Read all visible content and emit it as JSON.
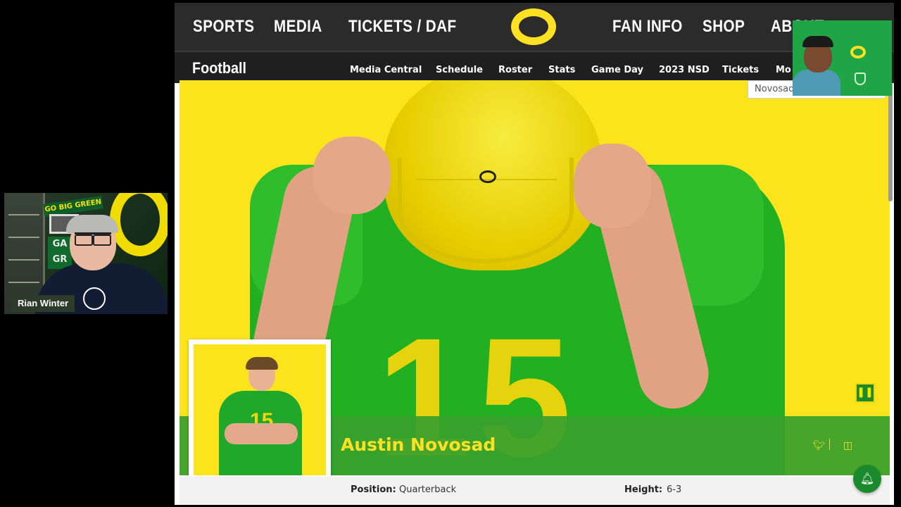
{
  "webcam_left": {
    "banner_text": "GO BIG GREEN",
    "wall_text": "GA GR",
    "name_tag": "Rian Winter"
  },
  "topnav": {
    "items": [
      "SPORTS",
      "MEDIA",
      "TICKETS / DAF",
      "FAN INFO",
      "SHOP",
      "ABOUT"
    ],
    "logo": "oregon-o-logo"
  },
  "subnav": {
    "title": "Football",
    "links": [
      "Media Central",
      "Schedule",
      "Roster",
      "Stats",
      "Game Day",
      "2023 NSD",
      "Tickets",
      "Mo"
    ]
  },
  "search": {
    "value": "Novosad"
  },
  "hero": {
    "jersey_number": "15",
    "pause_icon": "pause-icon"
  },
  "player": {
    "name": "Austin Novosad",
    "social": [
      "twitter-icon",
      "instagram-icon"
    ],
    "headshot_number": "15"
  },
  "info": {
    "position_label": "Position:",
    "position_value": "Quarterback",
    "height_label": "Height:",
    "height_value": "6-3"
  },
  "colors": {
    "oregon_yellow": "#fee123",
    "oregon_green": "#1f9a2c",
    "nav_bg": "#2b2b2b"
  }
}
